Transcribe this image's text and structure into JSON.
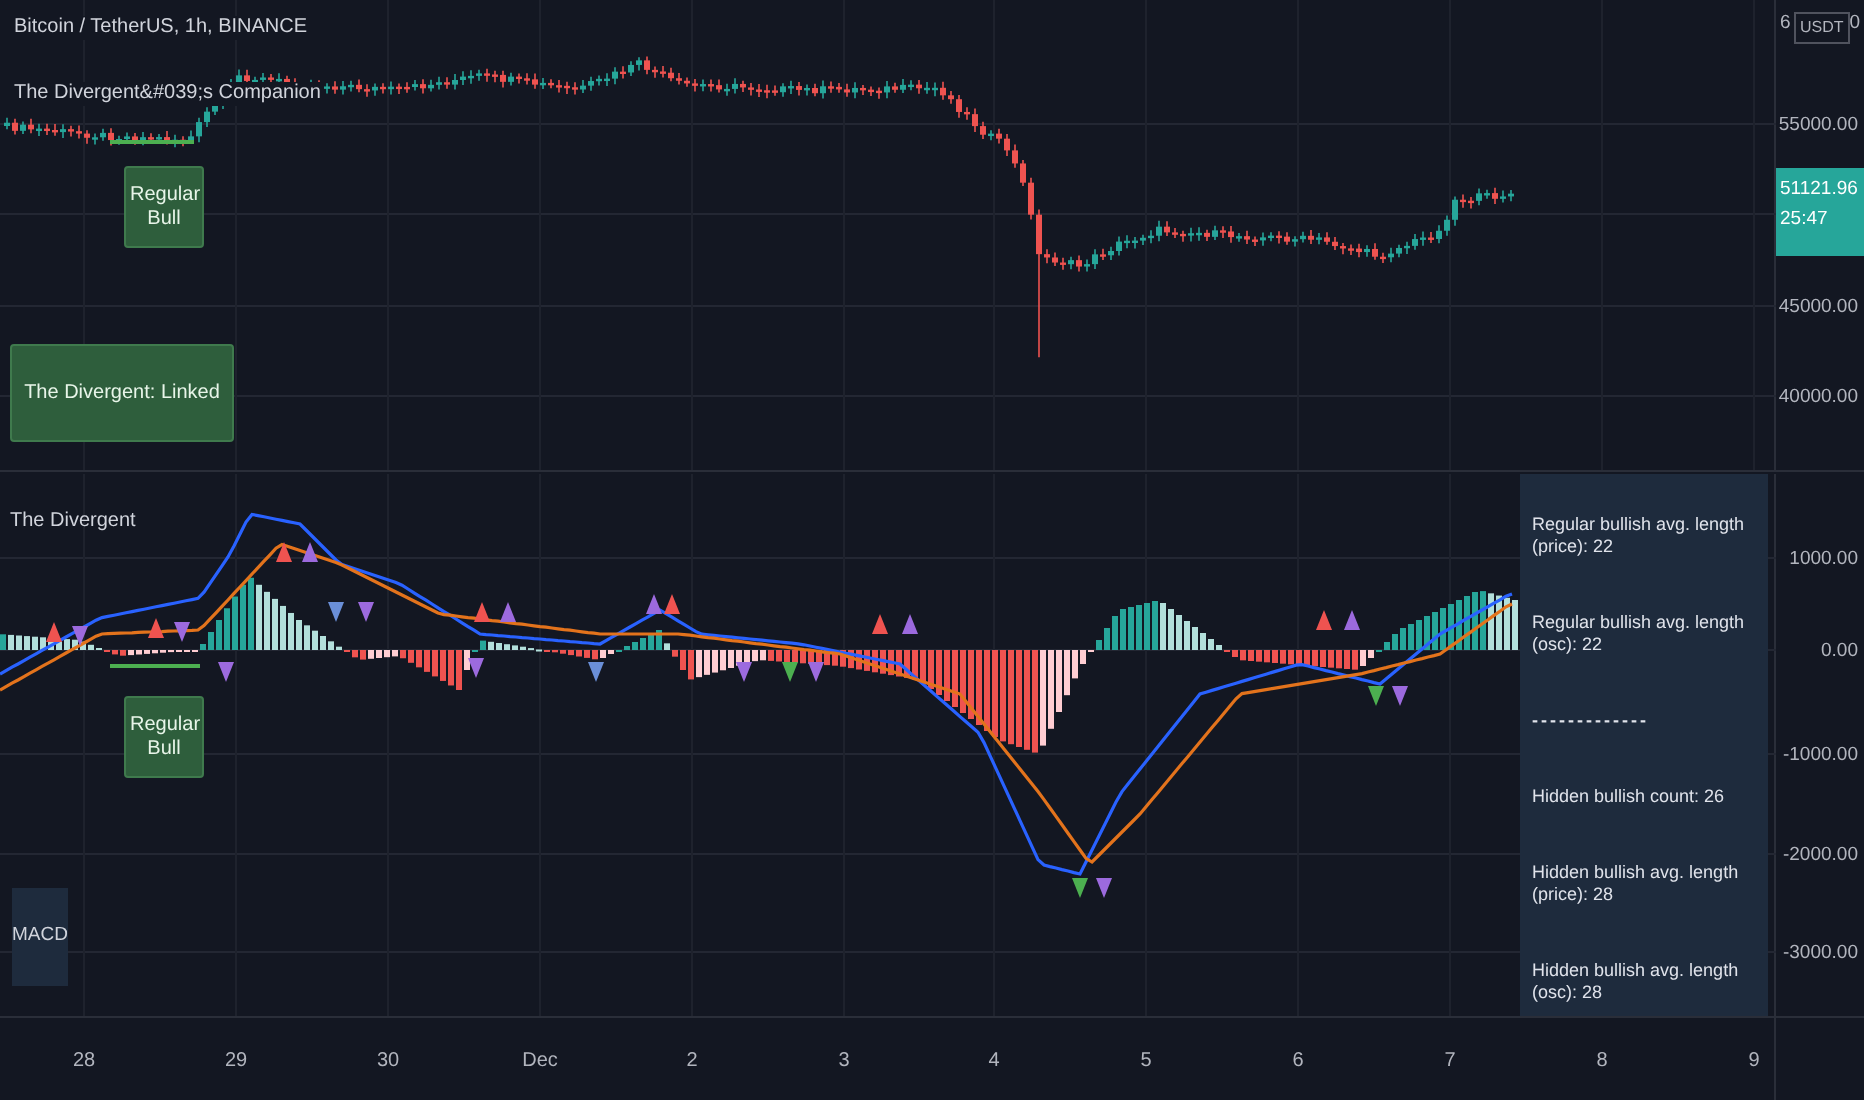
{
  "price_pane": {
    "legend": [
      "Bitcoin / TetherUS, 1h, BINANCE",
      "The Divergent&#039;s Companion"
    ],
    "signal_label": "Regular Bull",
    "status_label": "The Divergent: Linked"
  },
  "price_axis": {
    "top_fragments": [
      "6",
      "0"
    ],
    "currency": "USDT",
    "labels": [
      "55000.00",
      "45000.00",
      "40000.00"
    ],
    "last_price": "51121.96",
    "countdown": "25:47"
  },
  "oscillator_pane": {
    "title": "The Divergent",
    "signal_label": "Regular Bull",
    "indicator_label": "MACD",
    "stats": [
      {
        "kind": "text",
        "text": "Regular bullish avg. length (price): 22"
      },
      {
        "kind": "text",
        "text": "Regular bullish avg. length (osc): 22"
      },
      {
        "kind": "separator",
        "text": "-------------"
      },
      {
        "kind": "text",
        "text": "Hidden bullish count: 26"
      },
      {
        "kind": "text",
        "text": "Hidden bullish avg. length (price): 28"
      },
      {
        "kind": "text",
        "text": "Hidden bullish avg. length (osc): 28"
      }
    ]
  },
  "oscillator_axis": {
    "labels": [
      "1000.00",
      "0.00",
      "-1000.00",
      "-2000.00",
      "-3000.00"
    ]
  },
  "time_axis": {
    "labels": [
      "28",
      "29",
      "30",
      "Dec",
      "2",
      "3",
      "4",
      "5",
      "6",
      "7",
      "8",
      "9"
    ]
  }
}
